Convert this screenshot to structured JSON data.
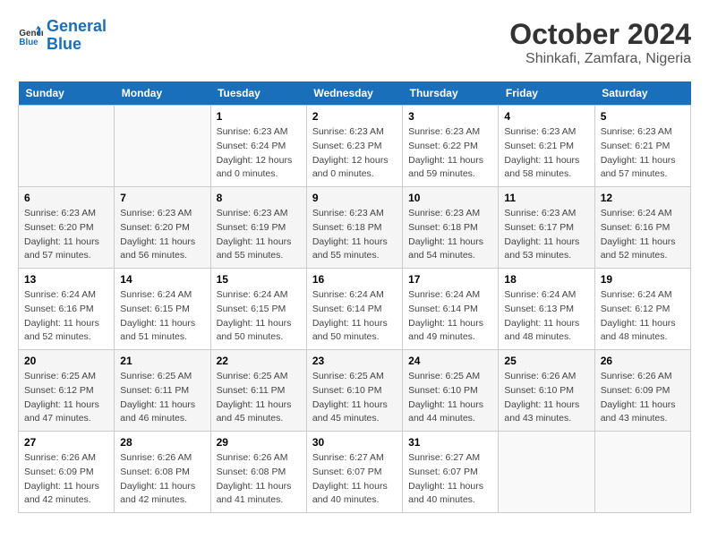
{
  "logo": {
    "line1": "General",
    "line2": "Blue"
  },
  "title": "October 2024",
  "subtitle": "Shinkafi, Zamfara, Nigeria",
  "days_of_week": [
    "Sunday",
    "Monday",
    "Tuesday",
    "Wednesday",
    "Thursday",
    "Friday",
    "Saturday"
  ],
  "weeks": [
    [
      {
        "day": "",
        "info": ""
      },
      {
        "day": "",
        "info": ""
      },
      {
        "day": "1",
        "info": "Sunrise: 6:23 AM\nSunset: 6:24 PM\nDaylight: 12 hours and 0 minutes."
      },
      {
        "day": "2",
        "info": "Sunrise: 6:23 AM\nSunset: 6:23 PM\nDaylight: 12 hours and 0 minutes."
      },
      {
        "day": "3",
        "info": "Sunrise: 6:23 AM\nSunset: 6:22 PM\nDaylight: 11 hours and 59 minutes."
      },
      {
        "day": "4",
        "info": "Sunrise: 6:23 AM\nSunset: 6:21 PM\nDaylight: 11 hours and 58 minutes."
      },
      {
        "day": "5",
        "info": "Sunrise: 6:23 AM\nSunset: 6:21 PM\nDaylight: 11 hours and 57 minutes."
      }
    ],
    [
      {
        "day": "6",
        "info": "Sunrise: 6:23 AM\nSunset: 6:20 PM\nDaylight: 11 hours and 57 minutes."
      },
      {
        "day": "7",
        "info": "Sunrise: 6:23 AM\nSunset: 6:20 PM\nDaylight: 11 hours and 56 minutes."
      },
      {
        "day": "8",
        "info": "Sunrise: 6:23 AM\nSunset: 6:19 PM\nDaylight: 11 hours and 55 minutes."
      },
      {
        "day": "9",
        "info": "Sunrise: 6:23 AM\nSunset: 6:18 PM\nDaylight: 11 hours and 55 minutes."
      },
      {
        "day": "10",
        "info": "Sunrise: 6:23 AM\nSunset: 6:18 PM\nDaylight: 11 hours and 54 minutes."
      },
      {
        "day": "11",
        "info": "Sunrise: 6:23 AM\nSunset: 6:17 PM\nDaylight: 11 hours and 53 minutes."
      },
      {
        "day": "12",
        "info": "Sunrise: 6:24 AM\nSunset: 6:16 PM\nDaylight: 11 hours and 52 minutes."
      }
    ],
    [
      {
        "day": "13",
        "info": "Sunrise: 6:24 AM\nSunset: 6:16 PM\nDaylight: 11 hours and 52 minutes."
      },
      {
        "day": "14",
        "info": "Sunrise: 6:24 AM\nSunset: 6:15 PM\nDaylight: 11 hours and 51 minutes."
      },
      {
        "day": "15",
        "info": "Sunrise: 6:24 AM\nSunset: 6:15 PM\nDaylight: 11 hours and 50 minutes."
      },
      {
        "day": "16",
        "info": "Sunrise: 6:24 AM\nSunset: 6:14 PM\nDaylight: 11 hours and 50 minutes."
      },
      {
        "day": "17",
        "info": "Sunrise: 6:24 AM\nSunset: 6:14 PM\nDaylight: 11 hours and 49 minutes."
      },
      {
        "day": "18",
        "info": "Sunrise: 6:24 AM\nSunset: 6:13 PM\nDaylight: 11 hours and 48 minutes."
      },
      {
        "day": "19",
        "info": "Sunrise: 6:24 AM\nSunset: 6:12 PM\nDaylight: 11 hours and 48 minutes."
      }
    ],
    [
      {
        "day": "20",
        "info": "Sunrise: 6:25 AM\nSunset: 6:12 PM\nDaylight: 11 hours and 47 minutes."
      },
      {
        "day": "21",
        "info": "Sunrise: 6:25 AM\nSunset: 6:11 PM\nDaylight: 11 hours and 46 minutes."
      },
      {
        "day": "22",
        "info": "Sunrise: 6:25 AM\nSunset: 6:11 PM\nDaylight: 11 hours and 45 minutes."
      },
      {
        "day": "23",
        "info": "Sunrise: 6:25 AM\nSunset: 6:10 PM\nDaylight: 11 hours and 45 minutes."
      },
      {
        "day": "24",
        "info": "Sunrise: 6:25 AM\nSunset: 6:10 PM\nDaylight: 11 hours and 44 minutes."
      },
      {
        "day": "25",
        "info": "Sunrise: 6:26 AM\nSunset: 6:10 PM\nDaylight: 11 hours and 43 minutes."
      },
      {
        "day": "26",
        "info": "Sunrise: 6:26 AM\nSunset: 6:09 PM\nDaylight: 11 hours and 43 minutes."
      }
    ],
    [
      {
        "day": "27",
        "info": "Sunrise: 6:26 AM\nSunset: 6:09 PM\nDaylight: 11 hours and 42 minutes."
      },
      {
        "day": "28",
        "info": "Sunrise: 6:26 AM\nSunset: 6:08 PM\nDaylight: 11 hours and 42 minutes."
      },
      {
        "day": "29",
        "info": "Sunrise: 6:26 AM\nSunset: 6:08 PM\nDaylight: 11 hours and 41 minutes."
      },
      {
        "day": "30",
        "info": "Sunrise: 6:27 AM\nSunset: 6:07 PM\nDaylight: 11 hours and 40 minutes."
      },
      {
        "day": "31",
        "info": "Sunrise: 6:27 AM\nSunset: 6:07 PM\nDaylight: 11 hours and 40 minutes."
      },
      {
        "day": "",
        "info": ""
      },
      {
        "day": "",
        "info": ""
      }
    ]
  ]
}
